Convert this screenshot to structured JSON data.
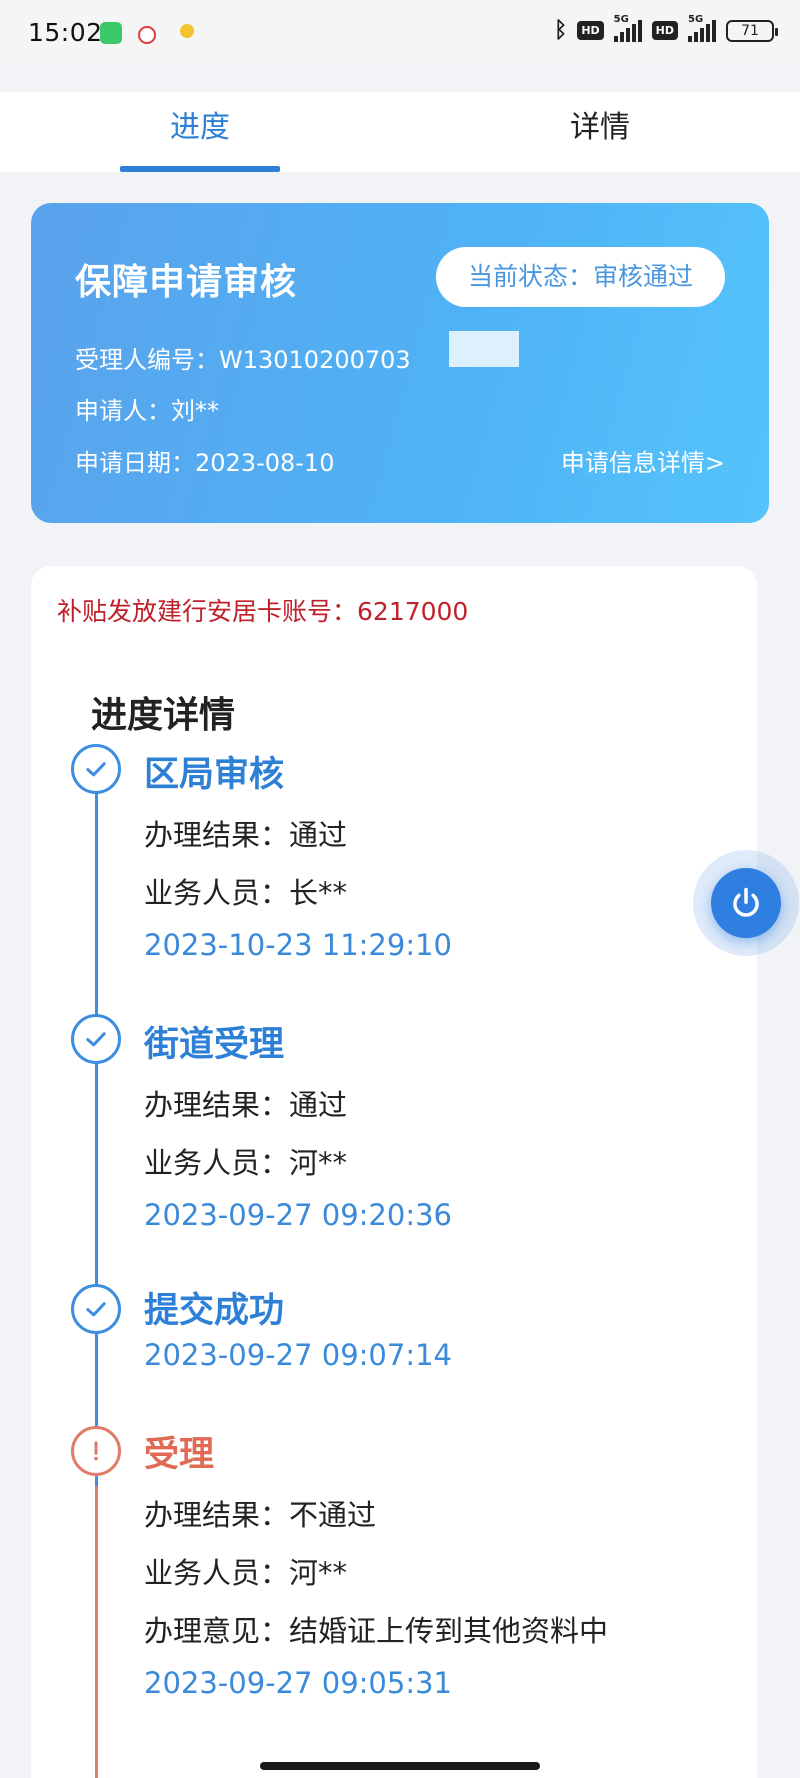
{
  "status_bar": {
    "time": "15:02",
    "hd_label": "HD",
    "network": "5G",
    "battery": "71"
  },
  "tabs": [
    {
      "label": "进度",
      "active": true
    },
    {
      "label": "详情",
      "active": false
    }
  ],
  "application": {
    "title": "保障申请审核",
    "status_label": "当前状态：审核通过",
    "handler_id": "受理人编号：W13010200703",
    "applicant": "申请人：刘**",
    "apply_date": "申请日期：2023-08-10",
    "detail_link": "申请信息详情>"
  },
  "progress": {
    "subsidy_account": "补贴发放建行安居卡账号：6217000",
    "section_title": "进度详情",
    "steps": [
      {
        "title": "区局审核",
        "status": "success",
        "result": "办理结果：通过",
        "staff": "业务人员：长**",
        "time": "2023-10-23 11:29:10"
      },
      {
        "title": "街道受理",
        "status": "success",
        "result": "办理结果：通过",
        "staff": "业务人员：河**",
        "time": "2023-09-27 09:20:36"
      },
      {
        "title": "提交成功",
        "status": "success",
        "time": "2023-09-27 09:07:14"
      },
      {
        "title": "受理",
        "status": "warning",
        "result": "办理结果：不通过",
        "staff": "业务人员：河**",
        "opinion": "办理意见：结婚证上传到其他资料中",
        "time": "2023-09-27 09:05:31"
      }
    ]
  },
  "icons": {
    "check": "check-circle-icon",
    "warning": "exclamation-circle-icon",
    "power": "power-icon"
  },
  "colors": {
    "accent": "#2e7fd6",
    "card_gradient_start": "#5aa2ec",
    "card_gradient_end": "#55c4fb",
    "warning": "#e06a53",
    "subsidy_text": "#c0202a"
  }
}
